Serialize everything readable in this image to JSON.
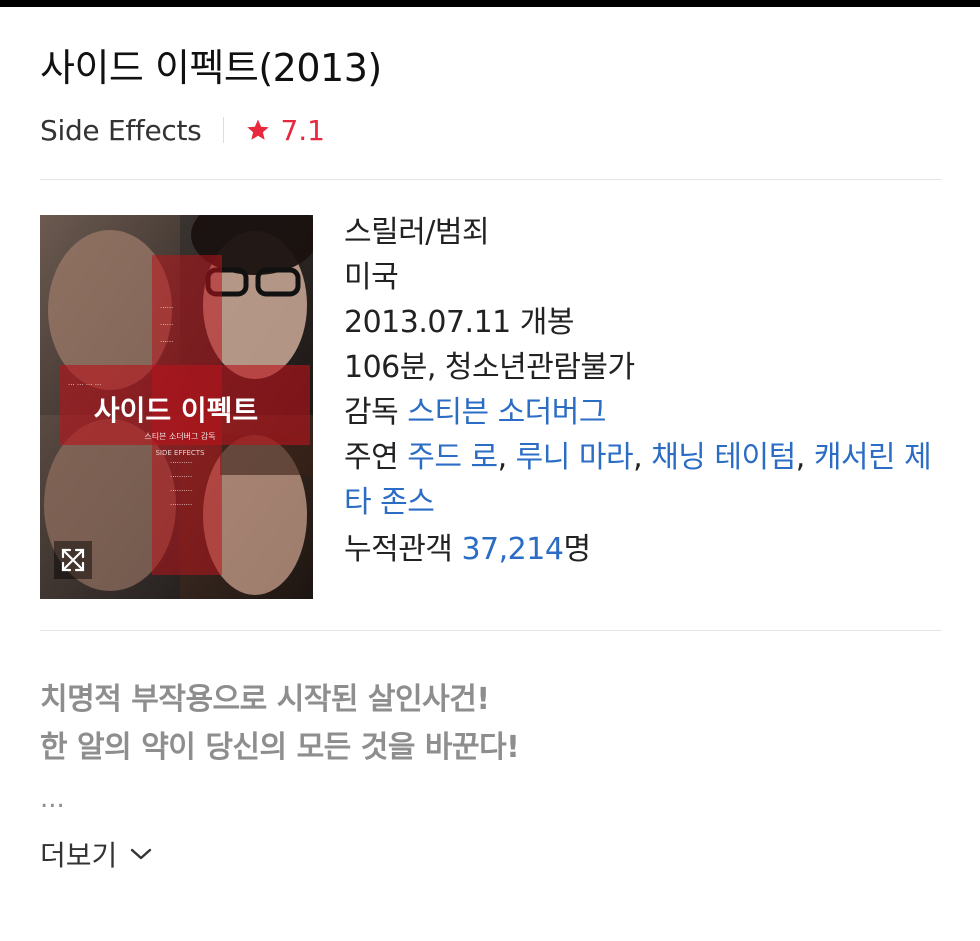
{
  "movie": {
    "title": "사이드 이펙트(2013)",
    "original_title": "Side Effects",
    "rating": "7.1",
    "accent_color": "#e8283c",
    "link_color": "#2b6cc4"
  },
  "info": {
    "genre": "스릴러/범죄",
    "country": "미국",
    "release": "2013.07.11 개봉",
    "runtime_rating": "106분, 청소년관람불가",
    "director_label": "감독",
    "director": "스티븐 소더버그",
    "cast_label": "주연",
    "cast": [
      "주드 로",
      "루니 마라",
      "채닝 테이텀",
      "캐서린 제타 존스"
    ],
    "audience_label": "누적관객",
    "audience_count": "37,214",
    "audience_unit": "명"
  },
  "poster": {
    "title_text": "사이드 이펙트",
    "director_text": "스티븐 소더버그 감독",
    "subtitle_text": "SIDE EFFECTS",
    "expand_icon": "expand-icon"
  },
  "synopsis": {
    "line1": "치명적 부작용으로 시작된 살인사건!",
    "line2": "한 알의 약이 당신의 모든 것을 바꾼다!",
    "ellipsis": "...",
    "more_label": "더보기"
  }
}
